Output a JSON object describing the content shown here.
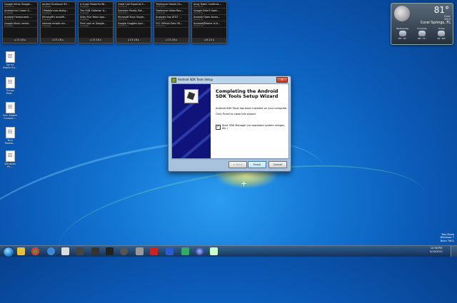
{
  "feeds": [
    {
      "items": [
        {
          "title": "Google Intros Google...",
          "meta": "TecHub Tu..."
        },
        {
          "title": "Android Ice Cream S...",
          "meta": "Engadget"
        },
        {
          "title": "Android Honeycomb ...",
          "meta": "TecHub Tu..."
        },
        {
          "title": "Google Music versio...",
          "meta": "Engadget"
        }
      ],
      "range": "13-18"
    },
    {
      "items": [
        {
          "title": "Alcatel Onetouch 90...",
          "meta": "Engadget"
        },
        {
          "title": "T-Mobile now dising...",
          "meta": "Engadget"
        },
        {
          "title": "Microsoft's amplifi...",
          "meta": "Engadget"
        },
        {
          "title": "Internal emails rev...",
          "meta": "Engadget"
        }
      ],
      "range": "13-18"
    },
    {
      "items": [
        {
          "title": "A Super Powerful Wi...",
          "meta": "Engadget"
        },
        {
          "title": "The 5GB Collector &...",
          "meta": "Engadget"
        },
        {
          "title": "Sixty Five Years Ago...",
          "meta": "Engadget"
        },
        {
          "title": "First Look at Google...",
          "meta": "Engadget"
        }
      ],
      "range": "13-18"
    },
    {
      "items": [
        {
          "title": "Great Call Expands S...",
          "meta": "TecHub Tu..."
        },
        {
          "title": "Symbian Finally Get...",
          "meta": "TecHub Tu..."
        },
        {
          "title": "Microsoft Buys Skype...",
          "meta": "TecHub Tu..."
        },
        {
          "title": "Google Goggles Upd...",
          "meta": "TecHub Tu..."
        }
      ],
      "range": "13-18"
    },
    {
      "items": [
        {
          "title": "Treehouse Hands On...",
          "meta": "TecHub Tu..."
        },
        {
          "title": "Treehouse Video Rou...",
          "meta": "TecHub Tu..."
        },
        {
          "title": "Analysts Say AT&T ...",
          "meta": "TecHub Tu..."
        },
        {
          "title": "FCC Official Gets OK...",
          "meta": "TecHub Tu..."
        }
      ],
      "range": "13-18"
    },
    {
      "items": [
        {
          "title": "Andy Rubin Confirms...",
          "meta": "TecHub Tu..."
        },
        {
          "title": "Google Didn't Open...",
          "meta": "TecHub Tu..."
        },
        {
          "title": "Android Open Acces...",
          "meta": "TecHub Tu..."
        },
        {
          "title": "Android@Home Is N...",
          "meta": "TecHub Tu..."
        }
      ],
      "range": "6-12"
    }
  ],
  "weather": {
    "temp": "81°",
    "details_line1": "Clear",
    "details_line2": "Wind",
    "city": "Coral Springs, FL",
    "days": [
      {
        "name": "Wednesday",
        "hi": "85°",
        "lo": "70°"
      },
      {
        "name": "Thursday",
        "hi": "86°",
        "lo": "71°"
      },
      {
        "name": "Friday",
        "hi": "84°",
        "lo": "68°"
      }
    ]
  },
  "desktop_icons": [
    {
      "label": "Sprint Mobile Bu..."
    },
    {
      "label": "Things Mob..."
    },
    {
      "label": "Tech Mobile Compan..."
    },
    {
      "label": "Tech Mobile..."
    },
    {
      "label": "Windows Ph..."
    }
  ],
  "dialog": {
    "title": "Android SDK Tools Setup",
    "close_label": "✕",
    "heading": "Completing the Android SDK Tools Setup Wizard",
    "text1": "Android SDK Tools has been installed on your computer.",
    "text2": "Click Finish to close this wizard.",
    "checkbox_checked": true,
    "checkbox_label": "Start SDK Manager (to download system images, etc.)",
    "back_label": "< Back",
    "finish_label": "Finish",
    "cancel_label": "Cancel"
  },
  "build": {
    "line1": "Test Mode",
    "line2": "Windows 7",
    "line3": "Build 7601"
  },
  "taskbar": {
    "time": "12:56 PM",
    "date": "5/10/2011"
  },
  "colors": {
    "dialog_side": "#10147a",
    "accent_blue": "#1477d4"
  }
}
